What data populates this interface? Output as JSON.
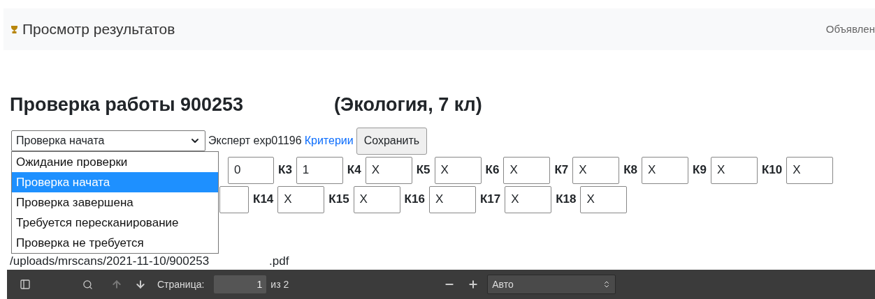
{
  "header": {
    "title": "Просмотр результатов",
    "right_link": "Объявлен"
  },
  "work": {
    "title": "Проверка работы 900253",
    "subject": "(Экология, 7 кл)"
  },
  "status_select": {
    "value": "Проверка начата",
    "expanded": true,
    "options": [
      {
        "label": "Ожидание проверки",
        "selected": false
      },
      {
        "label": "Проверка начата",
        "selected": true
      },
      {
        "label": "Проверка завершена",
        "selected": false
      },
      {
        "label": "Требуется пересканирование",
        "selected": false
      },
      {
        "label": "Проверка не требуется",
        "selected": false
      }
    ]
  },
  "expert": "Эксперт exp01196",
  "criteria_link": "Критерии",
  "save_button": "Сохранить",
  "criteria_rows": [
    [
      {
        "value": "0"
      },
      {
        "label": "К3",
        "value": "1"
      },
      {
        "label": "К4",
        "value": "X"
      },
      {
        "label": "К5",
        "value": "X"
      },
      {
        "label": "К6",
        "value": "X"
      },
      {
        "label": "К7",
        "value": "X"
      },
      {
        "label": "К8",
        "value": "X"
      },
      {
        "label": "К9",
        "value": "X"
      },
      {
        "label": "К10",
        "value": "X"
      }
    ],
    [
      {},
      {
        "label": "К14",
        "value": "X"
      },
      {
        "label": "К15",
        "value": "X"
      },
      {
        "label": "К16",
        "value": "X"
      },
      {
        "label": "К17",
        "value": "X"
      },
      {
        "label": "К18",
        "value": "X"
      }
    ]
  ],
  "file_path": "/uploads/mrscans/2021-11-10/900253",
  "file_ext": ".pdf",
  "pdf_toolbar": {
    "page_label": "Страница:",
    "page": "1",
    "page_total": "из 2",
    "zoom": "Авто"
  }
}
